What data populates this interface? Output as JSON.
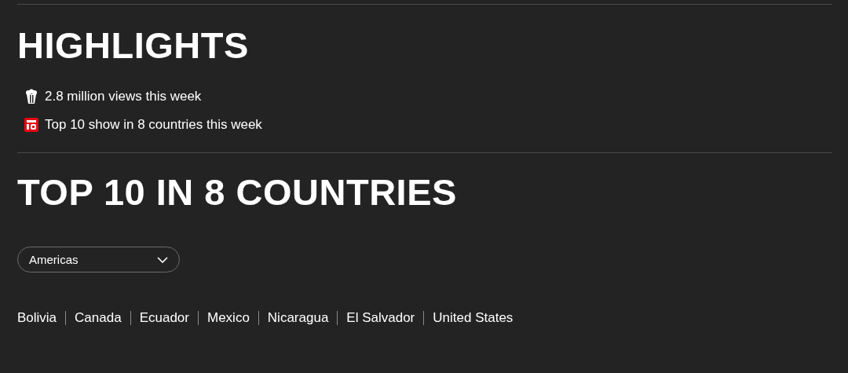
{
  "highlights": {
    "title": "HIGHLIGHTS",
    "items": [
      {
        "kind": "popcorn",
        "text": "2.8 million views this week"
      },
      {
        "kind": "top10",
        "text": "Top 10 show in 8 countries this week"
      }
    ]
  },
  "top10": {
    "title": "TOP 10 IN 8 COUNTRIES",
    "region_select": {
      "value": "Americas"
    },
    "countries": [
      "Bolivia",
      "Canada",
      "Ecuador",
      "Mexico",
      "Nicaragua",
      "El Salvador",
      "United States"
    ]
  }
}
